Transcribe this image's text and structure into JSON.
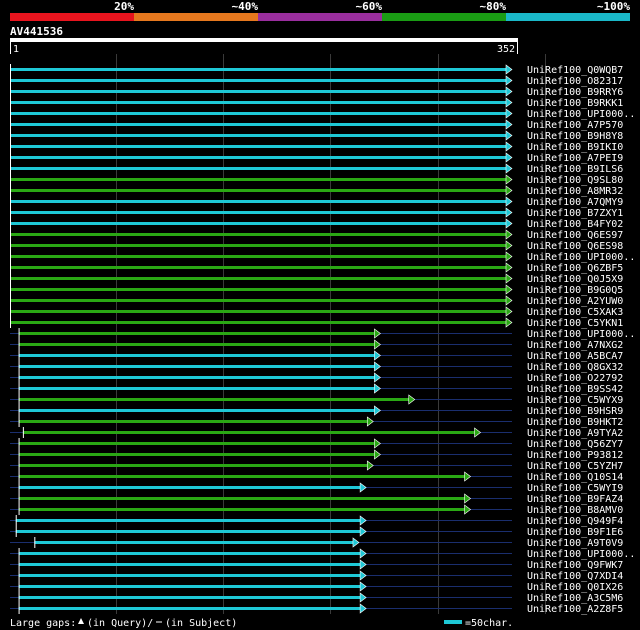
{
  "legend": {
    "thresholds": [
      "20%",
      "~40%",
      "~60%",
      "~80%",
      "~100%"
    ],
    "colors": [
      "#e8141e",
      "#e6781e",
      "#9a2e9e",
      "#1a9c14",
      "#1ab8c8"
    ]
  },
  "query": {
    "name": "AV441536",
    "start": "1",
    "end": "352"
  },
  "colors": {
    "cyan": "#1ec8d6",
    "green": "#2aa814",
    "query_bar": "#ffffff",
    "unaligned": "#1a2e6e",
    "grid": "#3a3a3a"
  },
  "footer": {
    "gaps_label": "Large gaps:",
    "in_query": "(in Query)/",
    "in_subject": "(in Subject)",
    "scale": "=50char."
  },
  "chart_data": {
    "type": "alignment",
    "x_range": [
      1,
      352
    ],
    "hits": [
      {
        "label": "UniRef100_Q0WQB7",
        "start": 1,
        "end": 352,
        "color": "cyan"
      },
      {
        "label": "UniRef100_O82317",
        "start": 1,
        "end": 352,
        "color": "cyan"
      },
      {
        "label": "UniRef100_B9RRY6",
        "start": 1,
        "end": 352,
        "color": "cyan"
      },
      {
        "label": "UniRef100_B9RKK1",
        "start": 1,
        "end": 352,
        "color": "cyan"
      },
      {
        "label": "UniRef100_UPI000..",
        "start": 1,
        "end": 352,
        "color": "cyan"
      },
      {
        "label": "UniRef100_A7P570",
        "start": 1,
        "end": 352,
        "color": "cyan"
      },
      {
        "label": "UniRef100_B9H8Y8",
        "start": 1,
        "end": 352,
        "color": "cyan"
      },
      {
        "label": "UniRef100_B9IKI0",
        "start": 1,
        "end": 352,
        "color": "cyan"
      },
      {
        "label": "UniRef100_A7PEI9",
        "start": 1,
        "end": 352,
        "color": "cyan"
      },
      {
        "label": "UniRef100_B9ILS6",
        "start": 1,
        "end": 352,
        "color": "cyan"
      },
      {
        "label": "UniRef100_Q9SL80",
        "start": 1,
        "end": 352,
        "color": "green"
      },
      {
        "label": "UniRef100_A8MR32",
        "start": 1,
        "end": 352,
        "color": "green"
      },
      {
        "label": "UniRef100_A7QMY9",
        "start": 1,
        "end": 352,
        "color": "cyan"
      },
      {
        "label": "UniRef100_B7ZXY1",
        "start": 1,
        "end": 352,
        "color": "cyan"
      },
      {
        "label": "UniRef100_B4FY02",
        "start": 1,
        "end": 352,
        "color": "cyan"
      },
      {
        "label": "UniRef100_Q6ES97",
        "start": 1,
        "end": 352,
        "color": "green"
      },
      {
        "label": "UniRef100_Q6ES98",
        "start": 1,
        "end": 352,
        "color": "green"
      },
      {
        "label": "UniRef100_UPI000..",
        "start": 1,
        "end": 352,
        "color": "green"
      },
      {
        "label": "UniRef100_Q6ZBF5",
        "start": 1,
        "end": 352,
        "color": "green"
      },
      {
        "label": "UniRef100_Q0J5X9",
        "start": 1,
        "end": 352,
        "color": "green"
      },
      {
        "label": "UniRef100_B9G0Q5",
        "start": 1,
        "end": 352,
        "color": "green"
      },
      {
        "label": "UniRef100_A2YUW0",
        "start": 1,
        "end": 352,
        "color": "green"
      },
      {
        "label": "UniRef100_C5XAK3",
        "start": 1,
        "end": 352,
        "color": "green"
      },
      {
        "label": "UniRef100_C5YKN1",
        "start": 1,
        "end": 352,
        "color": "green"
      },
      {
        "label": "UniRef100_UPI000..",
        "start": 7,
        "end": 260,
        "color": "green"
      },
      {
        "label": "UniRef100_A7NXG2",
        "start": 7,
        "end": 260,
        "color": "green"
      },
      {
        "label": "UniRef100_A5BCA7",
        "start": 7,
        "end": 260,
        "color": "cyan"
      },
      {
        "label": "UniRef100_Q8GX32",
        "start": 7,
        "end": 260,
        "color": "cyan"
      },
      {
        "label": "UniRef100_O22792",
        "start": 7,
        "end": 260,
        "color": "cyan"
      },
      {
        "label": "UniRef100_B9SS42",
        "start": 7,
        "end": 260,
        "color": "cyan"
      },
      {
        "label": "UniRef100_C5WYX9",
        "start": 7,
        "end": 284,
        "color": "green"
      },
      {
        "label": "UniRef100_B9HSR9",
        "start": 7,
        "end": 260,
        "color": "cyan"
      },
      {
        "label": "UniRef100_B9HKT2",
        "start": 7,
        "end": 255,
        "color": "green"
      },
      {
        "label": "UniRef100_A9TYA2",
        "start": 10,
        "end": 330,
        "color": "green"
      },
      {
        "label": "UniRef100_Q56ZY7",
        "start": 7,
        "end": 260,
        "color": "green"
      },
      {
        "label": "UniRef100_P93812",
        "start": 7,
        "end": 260,
        "color": "green"
      },
      {
        "label": "UniRef100_C5YZH7",
        "start": 7,
        "end": 255,
        "color": "green"
      },
      {
        "label": "UniRef100_Q10S14",
        "start": 7,
        "end": 323,
        "color": "green"
      },
      {
        "label": "UniRef100_C5WYI9",
        "start": 7,
        "end": 250,
        "color": "cyan"
      },
      {
        "label": "UniRef100_B9FAZ4",
        "start": 7,
        "end": 323,
        "color": "green"
      },
      {
        "label": "UniRef100_B8AMV0",
        "start": 7,
        "end": 323,
        "color": "green"
      },
      {
        "label": "UniRef100_Q949F4",
        "start": 5,
        "end": 250,
        "color": "cyan"
      },
      {
        "label": "UniRef100_B9F1E6",
        "start": 5,
        "end": 250,
        "color": "cyan"
      },
      {
        "label": "UniRef100_A9T0V9",
        "start": 18,
        "end": 245,
        "color": "cyan"
      },
      {
        "label": "UniRef100_UPI000..",
        "start": 7,
        "end": 250,
        "color": "cyan"
      },
      {
        "label": "UniRef100_Q9FWK7",
        "start": 7,
        "end": 250,
        "color": "cyan"
      },
      {
        "label": "UniRef100_Q7XDI4",
        "start": 7,
        "end": 250,
        "color": "cyan"
      },
      {
        "label": "UniRef100_Q0IX26",
        "start": 7,
        "end": 250,
        "color": "cyan"
      },
      {
        "label": "UniRef100_A3C5M6",
        "start": 7,
        "end": 250,
        "color": "cyan"
      },
      {
        "label": "UniRef100_A2Z8F5",
        "start": 7,
        "end": 250,
        "color": "cyan"
      }
    ]
  }
}
